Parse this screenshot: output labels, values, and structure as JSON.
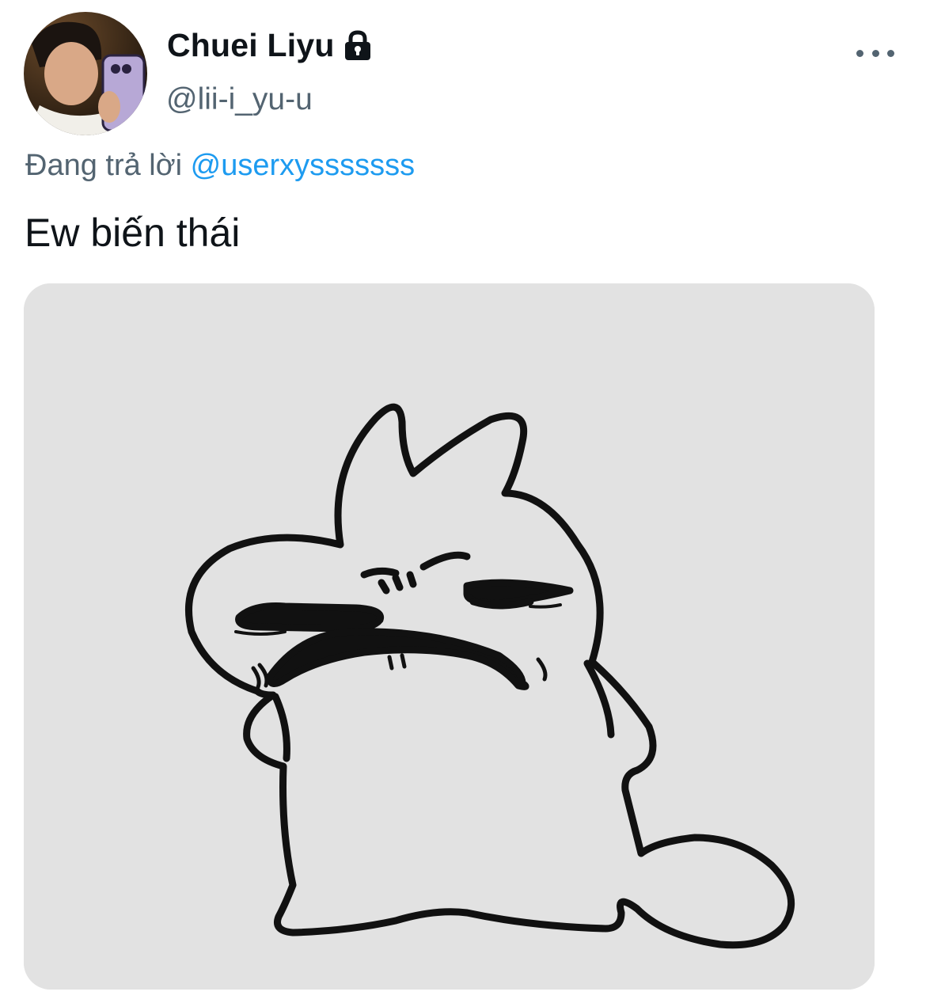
{
  "tweet": {
    "author": {
      "display_name": "Chuei Liyu",
      "handle": "@lii-i_yu-u",
      "protected_icon": "lock-icon",
      "avatar_icon": "avatar-photo"
    },
    "more_icon": "more-horizontal-icon",
    "reply": {
      "prefix": "Đang trả lời",
      "mention": "@userxysssssss"
    },
    "text": "Ew biến thái",
    "media": {
      "kind": "image",
      "subject": "grimacing-cartoon-creature",
      "background_color": "#e2e2e2"
    }
  },
  "colors": {
    "text_primary": "#0f1419",
    "text_secondary": "#536471",
    "link": "#1d9bf0"
  }
}
